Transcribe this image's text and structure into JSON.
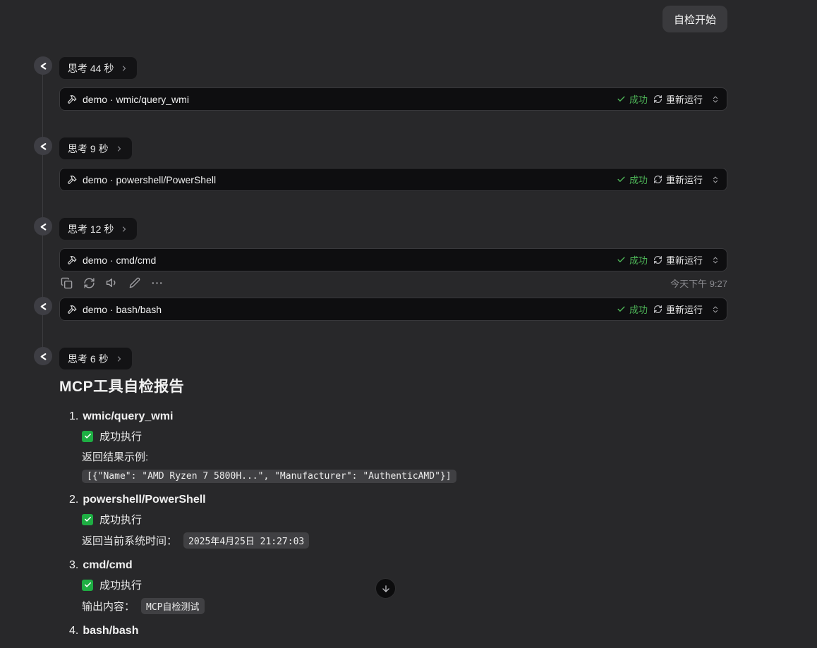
{
  "colors": {
    "page_bg": "#28282a",
    "success_green": "#4db457",
    "check_green": "#1eae43"
  },
  "user_message": "自检开始",
  "thinking_pills": [
    "思考 44 秒",
    "思考 9 秒",
    "思考 12 秒",
    "思考 6 秒"
  ],
  "tools": [
    {
      "title": "demo · wmic/query_wmi",
      "status": "成功",
      "rerun": "重新运行"
    },
    {
      "title": "demo · powershell/PowerShell",
      "status": "成功",
      "rerun": "重新运行"
    },
    {
      "title": "demo · cmd/cmd",
      "status": "成功",
      "rerun": "重新运行"
    },
    {
      "title": "demo · bash/bash",
      "status": "成功",
      "rerun": "重新运行"
    }
  ],
  "message_meta": {
    "timestamp": "今天下午 9:27"
  },
  "report": {
    "title": "MCP工具自检报告",
    "items": [
      {
        "num": "1.",
        "name": "wmic/query_wmi",
        "status": "成功执行",
        "label": "返回结果示例:",
        "code": "[{\"Name\": \"AMD Ryzen 7 5800H...\", \"Manufacturer\": \"AuthenticAMD\"}]"
      },
      {
        "num": "2.",
        "name": "powershell/PowerShell",
        "status": "成功执行",
        "label": "返回当前系统时间：",
        "code": "2025年4月25日 21:27:03"
      },
      {
        "num": "3.",
        "name": "cmd/cmd",
        "status": "成功执行",
        "label": "输出内容：",
        "code": "MCP自检测试"
      },
      {
        "num": "4.",
        "name": "bash/bash"
      }
    ]
  },
  "icons": {
    "avatar": "share-icon",
    "tool": "hammer-icon",
    "status": "check-icon",
    "rerun": "refresh-icon",
    "expand": "chevrons-up-down-icon",
    "actions": [
      "copy-icon",
      "refresh-icon",
      "volume-icon",
      "edit-icon",
      "more-icon"
    ],
    "scroll": "arrow-down-icon"
  }
}
